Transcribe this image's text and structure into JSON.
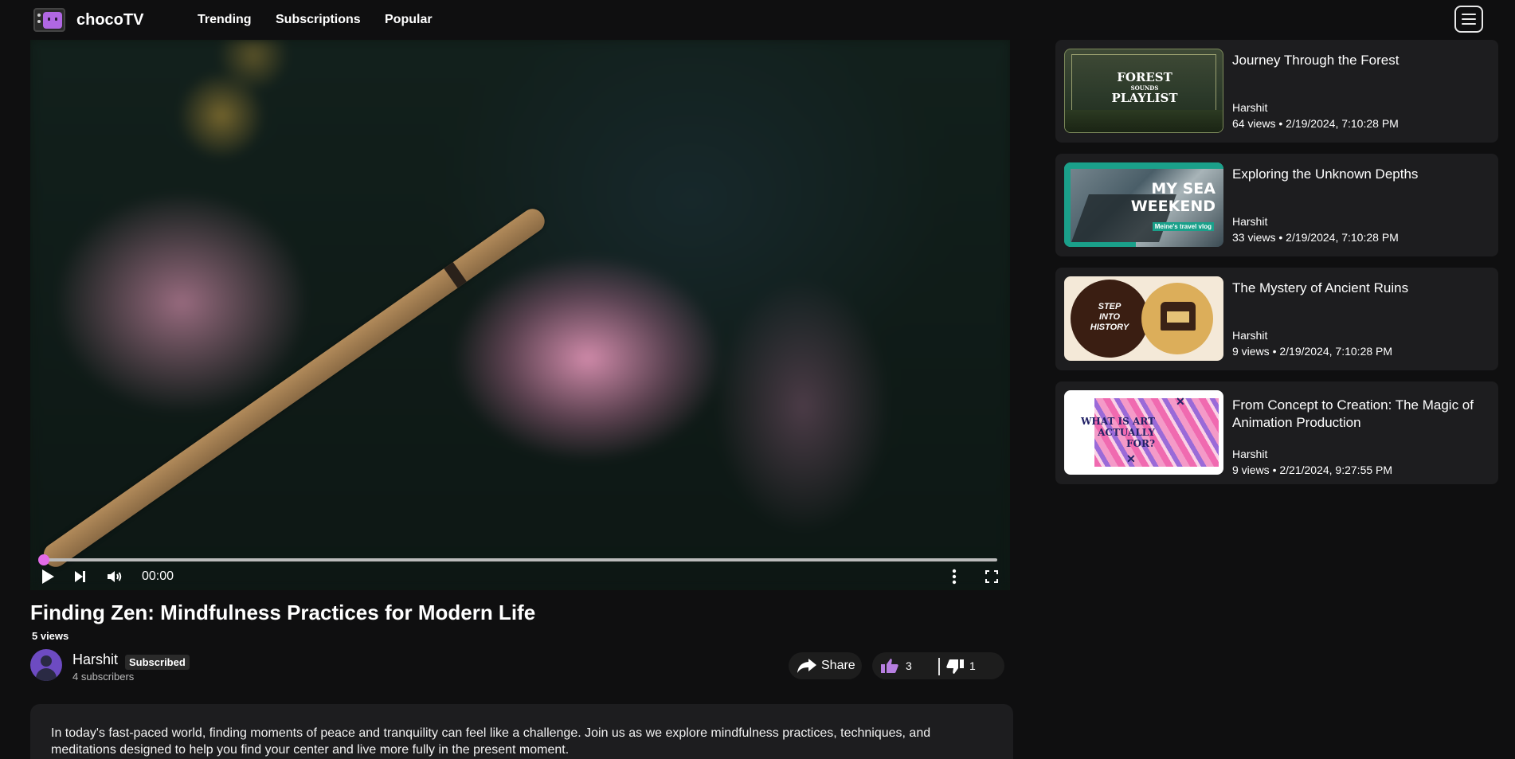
{
  "app": {
    "brand": "chocoTV"
  },
  "nav": {
    "items": [
      "Trending",
      "Subscriptions",
      "Popular"
    ]
  },
  "player": {
    "time": "00:00",
    "progress": 0
  },
  "video": {
    "title": "Finding Zen: Mindfulness Practices for Modern Life",
    "views": "5 views",
    "channel": "Harshit",
    "subscribed_label": "Subscribed",
    "subscribers": "4 subscribers",
    "share_label": "Share",
    "likes": "3",
    "dislikes": "1",
    "description": "In today's fast-paced world, finding moments of peace and tranquility can feel like a challenge. Join us as we explore mindfulness practices, techniques, and meditations designed to help you find your center and live more fully in the present moment."
  },
  "related": [
    {
      "title": "Journey Through the Forest",
      "channel": "Harshit",
      "views": "64 views",
      "date": "2/19/2024, 7:10:28 PM"
    },
    {
      "title": "Exploring the Unknown Depths",
      "channel": "Harshit",
      "views": "33 views",
      "date": "2/19/2024, 7:10:28 PM"
    },
    {
      "title": "The Mystery of Ancient Ruins",
      "channel": "Harshit",
      "views": "9 views",
      "date": "2/19/2024, 7:10:28 PM"
    },
    {
      "title": "From Concept to Creation: The Magic of Animation Production",
      "channel": "Harshit",
      "views": "9 views",
      "date": "2/21/2024, 9:27:55 PM"
    }
  ],
  "thumbs": {
    "forest": {
      "line1": "FOREST",
      "line2": "SOUNDS",
      "line3": "PLAYLIST"
    },
    "sea": {
      "line1": "MY SEA",
      "line2": "WEEKEND",
      "tag": "Meine's travel vlog"
    },
    "history": {
      "line1": "STEP",
      "line2": "INTO",
      "line3": "HISTORY"
    },
    "art": {
      "text": "WHAT IS ART ACTUALLY FOR?"
    }
  },
  "colors": {
    "accent": "#e26be8",
    "background": "#0f0f10",
    "card": "#1d1d1f"
  }
}
